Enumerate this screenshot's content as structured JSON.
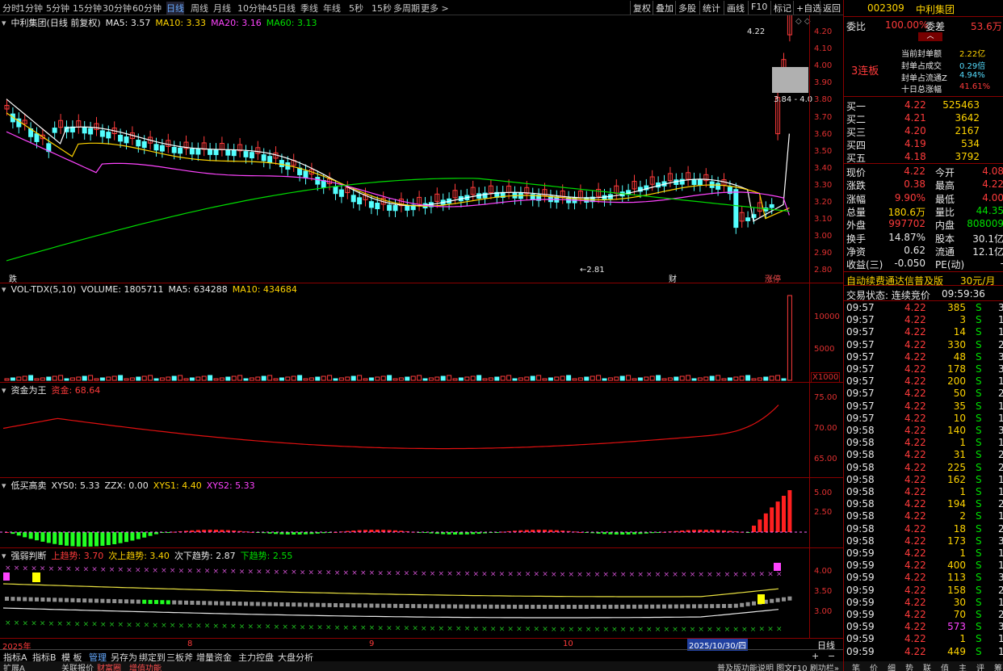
{
  "toolbar": {
    "periods": [
      "分时",
      "1分钟",
      "5分钟",
      "15分钟",
      "30分钟",
      "60分钟",
      "日线",
      "周线",
      "月线",
      "10分钟",
      "45日线",
      "季线",
      "年线",
      "5秒",
      "15秒",
      "多周期",
      "更多 >"
    ],
    "active_period": "日线",
    "buttons": [
      "复权",
      "叠加",
      "多股",
      "统计",
      "画线",
      "F10",
      "标记",
      "+自选",
      "返回"
    ]
  },
  "main_chart": {
    "title": "中利集团(日线 前复权)",
    "ma5": "MA5: 3.57",
    "ma10": "MA10: 3.33",
    "ma20": "MA20: 3.16",
    "ma60": "MA60: 3.13",
    "y_ticks": [
      "4.20",
      "4.10",
      "4.00",
      "3.90",
      "3.80",
      "3.70",
      "3.60",
      "3.50",
      "3.40",
      "3.30",
      "3.20",
      "3.10",
      "3.00",
      "2.90",
      "2.80"
    ],
    "high_label": "4.22",
    "low_label": "2.81",
    "range_label": "3.84 - 4.0",
    "marker_left": "跌",
    "marker_cai": "财",
    "marker_zhangting": "涨停"
  },
  "vol_chart": {
    "title": "VOL-TDX(5,10)",
    "volume": "VOLUME: 1805711",
    "ma5": "MA5: 634288",
    "ma10": "MA10: 434684",
    "y_ticks": [
      "10000",
      "5000"
    ],
    "unit": "X1000"
  },
  "fund_chart": {
    "title": "资金为王",
    "value": "资金: 68.64",
    "y_ticks": [
      "75.00",
      "70.00",
      "65.00"
    ]
  },
  "low_buy_chart": {
    "title": "低买高卖",
    "xys0": "XYS0: 5.33",
    "zzx": "ZZX: 0.00",
    "xys1": "XYS1: 4.40",
    "xys2": "XYS2: 5.33",
    "y_ticks": [
      "5.00",
      "2.50"
    ]
  },
  "strength_chart": {
    "title": "强弱判断",
    "up": "上趋势: 3.70",
    "sub_up": "次上趋势: 3.40",
    "sub_down": "次下趋势: 2.87",
    "down": "下趋势: 2.55",
    "y_ticks": [
      "4.00",
      "3.50",
      "3.00"
    ]
  },
  "x_axis": {
    "labels": [
      "2025年",
      "8",
      "9",
      "10"
    ],
    "cursor_date": "2025/10/30/四",
    "period": "日线"
  },
  "bottom_tabs": [
    "指标A",
    "指标B",
    "模 板",
    "管理",
    "另存为",
    "绑定到",
    "三板斧",
    "增量资金",
    "主力控盘",
    "大盘分析"
  ],
  "bottom_tabs2": [
    "扩展A",
    "关联报价",
    "财富圈",
    "增值功能"
  ],
  "status_right": "普及版功能说明 图文F10 刷功栏»",
  "right_tabs": [
    "笔",
    "价",
    "细",
    "势",
    "联",
    "值",
    "主",
    "评",
    "筹"
  ],
  "quote": {
    "code": "002309",
    "name": "中利集团",
    "weibi_label": "委比",
    "weibi": "100.00%",
    "weicha_label": "委差",
    "weicha": "53.6万",
    "lianban": "3连板",
    "seal_amount_label": "当前封单额",
    "seal_amount": "2.22亿",
    "seal_deal_label": "封单占成交",
    "seal_deal": "0.29倍",
    "seal_float_label": "封单占流通Z",
    "seal_float": "4.94%",
    "ten_day_label": "十日总涨幅",
    "ten_day": "41.61%",
    "bids": [
      {
        "label": "买一",
        "price": "4.22",
        "vol": "525463"
      },
      {
        "label": "买二",
        "price": "4.21",
        "vol": "3642"
      },
      {
        "label": "买三",
        "price": "4.20",
        "vol": "2167"
      },
      {
        "label": "买四",
        "price": "4.19",
        "vol": "534"
      },
      {
        "label": "买五",
        "price": "4.18",
        "vol": "3792"
      }
    ],
    "stats": [
      {
        "l1": "现价",
        "v1": "4.22",
        "l2": "今开",
        "v2": "4.08"
      },
      {
        "l1": "涨跌",
        "v1": "0.38",
        "l2": "最高",
        "v2": "4.22"
      },
      {
        "l1": "涨幅",
        "v1": "9.90%",
        "l2": "最低",
        "v2": "4.00"
      },
      {
        "l1": "总量",
        "v1": "180.6万",
        "l2": "量比",
        "v2": "44.35"
      },
      {
        "l1": "外盘",
        "v1": "997702",
        "l2": "内盘",
        "v2": "808009"
      },
      {
        "l1": "换手",
        "v1": "14.87%",
        "l2": "股本",
        "v2": "30.1亿"
      },
      {
        "l1": "净资",
        "v1": "0.62",
        "l2": "流通",
        "v2": "12.1亿"
      },
      {
        "l1": "收益(三)",
        "v1": "-0.050",
        "l2": "PE(动)",
        "v2": "-"
      }
    ],
    "ad": "自动续费通达信普及版",
    "ad_price": "30元/月",
    "trade_status": "交易状态: 连续竞价",
    "trade_time": "09:59:36"
  },
  "ticks": [
    [
      "09:57",
      "4.22",
      "385",
      "S",
      "3"
    ],
    [
      "09:57",
      "4.22",
      "3",
      "S",
      "1"
    ],
    [
      "09:57",
      "4.22",
      "14",
      "S",
      "1"
    ],
    [
      "09:57",
      "4.22",
      "330",
      "S",
      "2"
    ],
    [
      "09:57",
      "4.22",
      "48",
      "S",
      "3"
    ],
    [
      "09:57",
      "4.22",
      "178",
      "S",
      "3"
    ],
    [
      "09:57",
      "4.22",
      "200",
      "S",
      "1"
    ],
    [
      "09:57",
      "4.22",
      "50",
      "S",
      "2"
    ],
    [
      "09:57",
      "4.22",
      "35",
      "S",
      "1"
    ],
    [
      "09:57",
      "4.22",
      "10",
      "S",
      "1"
    ],
    [
      "09:58",
      "4.22",
      "140",
      "S",
      "3"
    ],
    [
      "09:58",
      "4.22",
      "1",
      "S",
      "1"
    ],
    [
      "09:58",
      "4.22",
      "31",
      "S",
      "2"
    ],
    [
      "09:58",
      "4.22",
      "225",
      "S",
      "2"
    ],
    [
      "09:58",
      "4.22",
      "162",
      "S",
      "1"
    ],
    [
      "09:58",
      "4.22",
      "1",
      "S",
      "1"
    ],
    [
      "09:58",
      "4.22",
      "194",
      "S",
      "2"
    ],
    [
      "09:58",
      "4.22",
      "2",
      "S",
      "1"
    ],
    [
      "09:58",
      "4.22",
      "18",
      "S",
      "2"
    ],
    [
      "09:58",
      "4.22",
      "173",
      "S",
      "3"
    ],
    [
      "09:59",
      "4.22",
      "1",
      "S",
      "1"
    ],
    [
      "09:59",
      "4.22",
      "400",
      "S",
      "1"
    ],
    [
      "09:59",
      "4.22",
      "113",
      "S",
      "3"
    ],
    [
      "09:59",
      "4.22",
      "158",
      "S",
      "2"
    ],
    [
      "09:59",
      "4.22",
      "30",
      "S",
      "1"
    ],
    [
      "09:59",
      "4.22",
      "70",
      "S",
      "2"
    ],
    [
      "09:59",
      "4.22",
      "573",
      "S",
      "3"
    ],
    [
      "09:59",
      "4.22",
      "1",
      "S",
      "1"
    ],
    [
      "09:59",
      "4.22",
      "449",
      "S",
      "1"
    ]
  ]
}
